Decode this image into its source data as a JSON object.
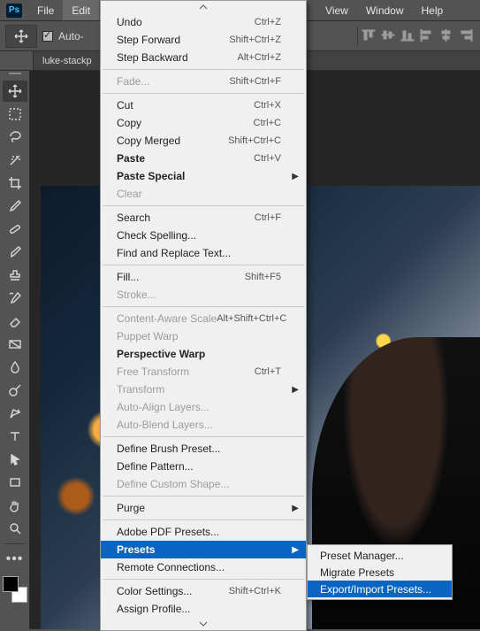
{
  "app": {
    "logo_text": "Ps"
  },
  "menubar": {
    "file": "File",
    "edit": "Edit",
    "view": "View",
    "window": "Window",
    "help": "Help"
  },
  "optbar": {
    "auto_select_label": "Auto-"
  },
  "doc_tab": {
    "title": "luke-stackp"
  },
  "edit_menu": {
    "undo": {
      "label": "Undo",
      "accel": "Ctrl+Z"
    },
    "step_forward": {
      "label": "Step Forward",
      "accel": "Shift+Ctrl+Z"
    },
    "step_backward": {
      "label": "Step Backward",
      "accel": "Alt+Ctrl+Z"
    },
    "fade": {
      "label": "Fade...",
      "accel": "Shift+Ctrl+F"
    },
    "cut": {
      "label": "Cut",
      "accel": "Ctrl+X"
    },
    "copy": {
      "label": "Copy",
      "accel": "Ctrl+C"
    },
    "copy_merged": {
      "label": "Copy Merged",
      "accel": "Shift+Ctrl+C"
    },
    "paste": {
      "label": "Paste",
      "accel": "Ctrl+V"
    },
    "paste_special": {
      "label": "Paste Special"
    },
    "clear": {
      "label": "Clear"
    },
    "search": {
      "label": "Search",
      "accel": "Ctrl+F"
    },
    "check_spelling": {
      "label": "Check Spelling..."
    },
    "find_replace": {
      "label": "Find and Replace Text..."
    },
    "fill": {
      "label": "Fill...",
      "accel": "Shift+F5"
    },
    "stroke": {
      "label": "Stroke..."
    },
    "content_aware": {
      "label": "Content-Aware Scale",
      "accel": "Alt+Shift+Ctrl+C"
    },
    "puppet_warp": {
      "label": "Puppet Warp"
    },
    "perspective_warp": {
      "label": "Perspective Warp"
    },
    "free_transform": {
      "label": "Free Transform",
      "accel": "Ctrl+T"
    },
    "transform": {
      "label": "Transform"
    },
    "auto_align": {
      "label": "Auto-Align Layers..."
    },
    "auto_blend": {
      "label": "Auto-Blend Layers..."
    },
    "define_brush": {
      "label": "Define Brush Preset..."
    },
    "define_pattern": {
      "label": "Define Pattern..."
    },
    "define_shape": {
      "label": "Define Custom Shape..."
    },
    "purge": {
      "label": "Purge"
    },
    "pdf_presets": {
      "label": "Adobe PDF Presets..."
    },
    "presets": {
      "label": "Presets"
    },
    "remote": {
      "label": "Remote Connections..."
    },
    "color_settings": {
      "label": "Color Settings...",
      "accel": "Shift+Ctrl+K"
    },
    "assign_profile": {
      "label": "Assign Profile..."
    }
  },
  "presets_submenu": {
    "manager": "Preset Manager...",
    "migrate": "Migrate Presets",
    "export_import": "Export/Import Presets..."
  },
  "colors": {
    "highlight": "#0a64c2"
  }
}
